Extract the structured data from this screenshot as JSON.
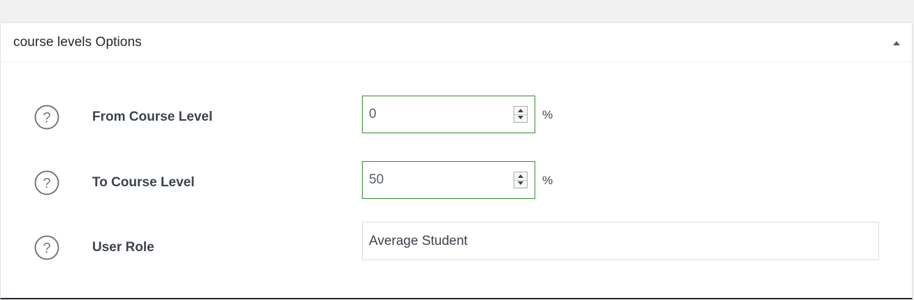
{
  "panel": {
    "title": "course levels Options",
    "toggle_icon": "triangle-up-icon"
  },
  "fields": [
    {
      "label": "From Course Level",
      "value": "0",
      "unit": "%",
      "type": "number"
    },
    {
      "label": "To Course Level",
      "value": "50",
      "unit": "%",
      "type": "number"
    },
    {
      "label": "User Role",
      "value": "Average Student",
      "type": "text"
    }
  ],
  "colors": {
    "input_focus_border": "#2e8b2e",
    "panel_background": "#ffffff",
    "page_background": "#f1f1f1",
    "label_text": "#3c434a"
  },
  "icons": {
    "help": "question-circle-icon",
    "spin_up": "spin-up-icon",
    "spin_down": "spin-down-icon"
  }
}
